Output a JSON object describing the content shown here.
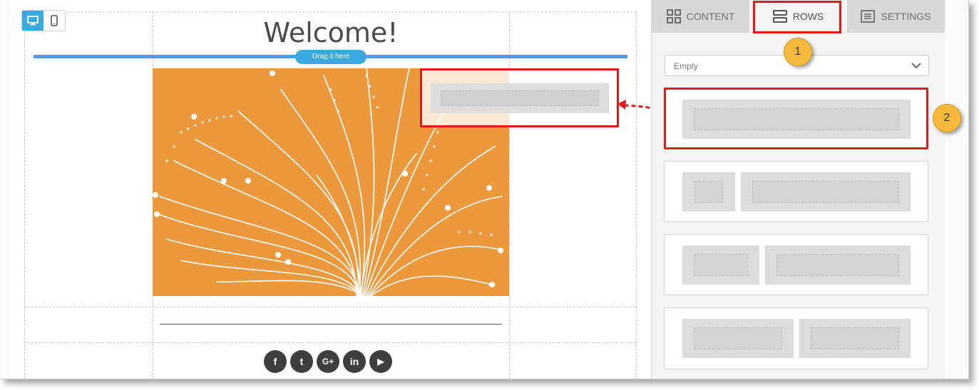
{
  "canvas": {
    "heading": "Welcome!",
    "drop_hint": "Drag it here",
    "device_toggle": [
      "desktop-icon",
      "mobile-icon"
    ],
    "active_device": "desktop",
    "social_icons": [
      "facebook-icon",
      "twitter-icon",
      "google-plus-icon",
      "linkedin-icon",
      "youtube-icon"
    ],
    "social_labels": [
      "f",
      "t",
      "G+",
      "in",
      "▶"
    ]
  },
  "panel": {
    "tabs": [
      {
        "label": "CONTENT",
        "icon": "grid-icon"
      },
      {
        "label": "ROWS",
        "icon": "rows-icon",
        "active": true
      },
      {
        "label": "SETTINGS",
        "icon": "settings-icon"
      }
    ],
    "row_filter": "Empty",
    "row_layouts": [
      "one-column",
      "one-third-two-thirds",
      "two-fifths-three-fifths",
      "half-half"
    ]
  },
  "annotations": {
    "step1": "1",
    "step2": "2"
  },
  "colors": {
    "accent": "#3aa9df",
    "highlight": "#e01b1b",
    "hero_bg": "#ec993e",
    "badge": "#f6b93b"
  }
}
